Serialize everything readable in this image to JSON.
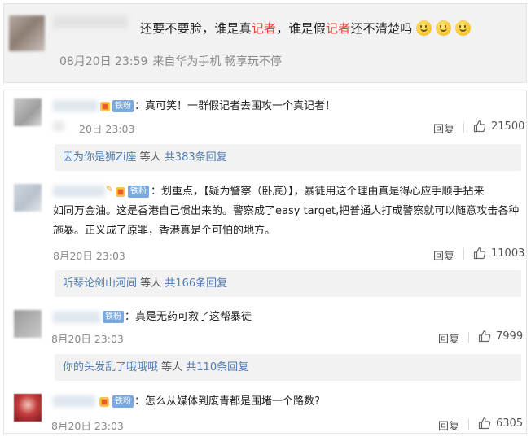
{
  "top_post": {
    "text_a": "还要不要脸，谁是真",
    "text_b": "记者",
    "text_c": "，谁是假",
    "text_d": "记者",
    "text_e": "还不清楚吗",
    "date": "08月20日 23:59",
    "source": "来自华为手机 畅享玩不停"
  },
  "comments": [
    {
      "badge": "铁粉",
      "text": "：真可笑！一群假记者去围攻一个真记者！",
      "time": "20日 23:03",
      "reply_label": "回复",
      "likes": "21500",
      "replies": {
        "users": "因为你是狮Zi座",
        "mid": " 等人 ",
        "count": "共383条回复"
      }
    },
    {
      "badge": "铁粉",
      "line1": "：划重点，【疑为警察（卧底）】，暴徒用这个理由真是得心应手顺手拈来",
      "line2": "如同万金油。这是香港自己惯出来的。警察成了easy target,把普通人打成警察就可以随意攻击各种",
      "line3": "施暴。正义成了原罪，香港真是个可怕的地方。",
      "time": "8月20日 23:03",
      "reply_label": "回复",
      "likes": "11003",
      "replies": {
        "users": "听琴论剑山河间",
        "mid": " 等人 ",
        "count": "共166条回复"
      }
    },
    {
      "badge": "铁粉",
      "text": "：真是无药可救了这帮暴徒",
      "time": "8月20日 23:03",
      "reply_label": "回复",
      "likes": "7999",
      "replies": {
        "users": "你的头发乱了哦哦哦",
        "mid": " 等人 ",
        "count": "共110条回复"
      }
    },
    {
      "badge": "铁粉",
      "text": "：怎么从媒体到废青都是围堵一个路数?",
      "time": "8月20日 23:03",
      "reply_label": "回复",
      "likes": "6305"
    }
  ],
  "colors": {
    "link": "#4f7db4",
    "highlight": "#e8433a",
    "badge": "#7aa9e0"
  }
}
